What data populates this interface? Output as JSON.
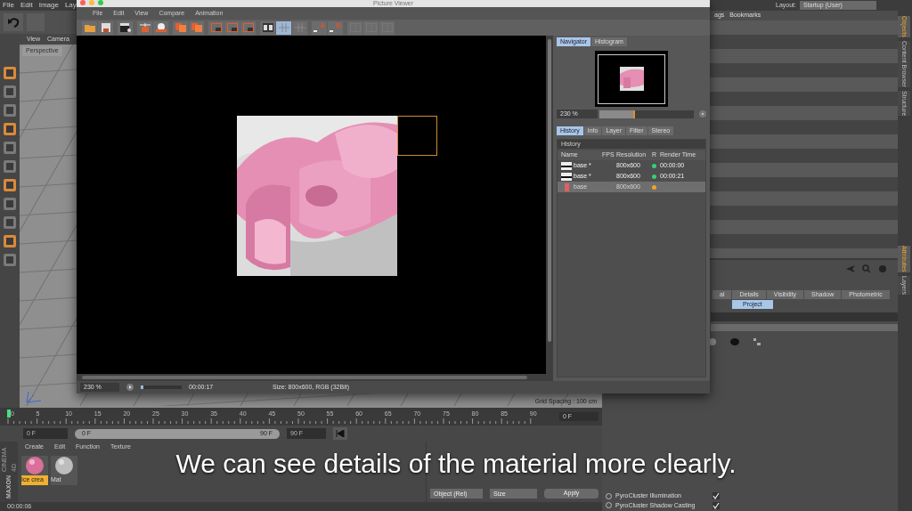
{
  "app_menu": [
    "File",
    "Edit",
    "Image",
    "Lay"
  ],
  "viewport": {
    "menu": [
      "View",
      "Camera"
    ],
    "camera": "Perspective",
    "hud": "Grid Spacing : 100 cm"
  },
  "layout": {
    "label": "Layout:",
    "value": "Startup (User)"
  },
  "object_manager": {
    "tabs": [
      "ags",
      "Bookmarks"
    ]
  },
  "side_tabs": [
    {
      "label": "Objects",
      "selected": true
    },
    {
      "label": "Content Browser",
      "selected": false
    },
    {
      "label": "Structure",
      "selected": false
    }
  ],
  "side_tabs_lower": [
    {
      "label": "Attributes",
      "selected": true
    },
    {
      "label": "Layers",
      "selected": false
    }
  ],
  "attributes": {
    "tabs": [
      {
        "label": "al",
        "selected": false
      },
      {
        "label": "Details",
        "selected": false
      },
      {
        "label": "Visibility",
        "selected": false
      },
      {
        "label": "Shadow",
        "selected": false
      },
      {
        "label": "Photometric",
        "selected": false
      }
    ],
    "subtabs": [
      {
        "label": "Project",
        "selected": true
      }
    ],
    "options": [
      {
        "label": "PyroCluster Illumination",
        "checked": true
      },
      {
        "label": "PyroCluster Shadow Casting",
        "checked": true
      }
    ]
  },
  "timeline": {
    "ticks": [
      "0",
      "5",
      "10",
      "15",
      "20",
      "25",
      "30",
      "35",
      "40",
      "45",
      "50",
      "55",
      "60",
      "65",
      "70",
      "75",
      "80",
      "85",
      "90"
    ],
    "frame_field": "0 F",
    "start": "0 F",
    "range": {
      "start": "0 F",
      "end": "90 F",
      "level": 1
    },
    "end": "90 F"
  },
  "materials": {
    "menu": [
      "Create",
      "Edit",
      "Function",
      "Texture"
    ],
    "items": [
      {
        "name": "Ice crea",
        "selected": true,
        "color": "#d96f9a"
      },
      {
        "name": "Mat",
        "selected": false,
        "color": "#bdbdbd"
      }
    ]
  },
  "coordinates": {
    "mode": "Object (Rel)",
    "size": "Size",
    "apply": "Apply"
  },
  "brand": [
    "MAXON",
    "CINEMA 4D"
  ],
  "status_bar": "00:00:06",
  "picture_viewer": {
    "title": "Picture Viewer",
    "menu": [
      "File",
      "Edit",
      "View",
      "Compare",
      "Animation"
    ],
    "toolbar": [
      {
        "kind": "folder"
      },
      {
        "kind": "disk"
      },
      {
        "kind": "clapper"
      },
      {
        "kind": "crop"
      },
      {
        "kind": "sphere"
      },
      {
        "kind": "copy"
      },
      {
        "kind": "copy"
      },
      {
        "kind": "frame"
      },
      {
        "kind": "frame"
      },
      {
        "kind": "frame"
      },
      {
        "kind": "compare"
      },
      {
        "kind": "grid"
      },
      {
        "kind": "grid"
      },
      {
        "kind": "marker",
        "label": "A"
      },
      {
        "kind": "marker",
        "label": "B"
      },
      {
        "kind": "split"
      },
      {
        "kind": "split"
      },
      {
        "kind": "split"
      }
    ],
    "navigator": {
      "tabs": [
        {
          "label": "Navigator",
          "selected": true
        },
        {
          "label": "Histogram",
          "selected": false
        }
      ],
      "zoom": "230 %",
      "level": 0.38
    },
    "tabs": [
      {
        "label": "History",
        "selected": true
      },
      {
        "label": "Info",
        "selected": false
      },
      {
        "label": "Layer",
        "selected": false
      },
      {
        "label": "Filter",
        "selected": false
      },
      {
        "label": "Stereo",
        "selected": false
      }
    ],
    "history": {
      "title": "History",
      "columns": [
        "Name",
        "FPS",
        "Resolution",
        "R",
        "Render Time"
      ],
      "rows": [
        {
          "name": "base *",
          "resolution": "800x600",
          "color": "#2fd37a",
          "render_time": "00:00:00",
          "selected": false
        },
        {
          "name": "base *",
          "resolution": "800x600",
          "color": "#2fd37a",
          "render_time": "00:00:21",
          "selected": false
        },
        {
          "name": "base",
          "resolution": "800x600",
          "color": "#f0a32a",
          "selected": true
        }
      ]
    },
    "footer": {
      "zoom": "230 %",
      "time": "00:00:17",
      "info": "Size: 800x600, RGB (32Bit)",
      "level": 0.06
    }
  },
  "subtitle": "We can see details of the material more clearly."
}
